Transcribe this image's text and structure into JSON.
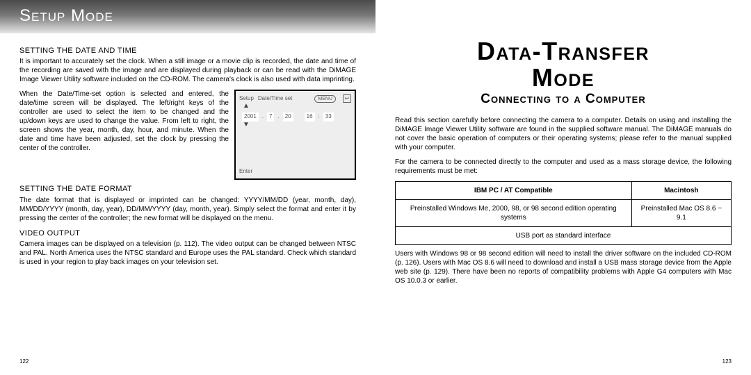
{
  "left": {
    "header": "Setup Mode",
    "h1": "Setting the Date and Time",
    "p1": "It is important to accurately set the clock. When a still image or a movie clip is recorded, the date and time of the recording are saved with the image and are displayed during playback or can be read with the DiMAGE Image Viewer Utility software included on the CD-ROM. The camera's clock is also used with data imprinting.",
    "p2": "When the Date/Time-set option is selected and entered, the date/time screen will be displayed. The left/right keys of the controller are used to select the item to be changed and the up/down keys are used to change the value. From left to right, the screen shows the year, month, day, hour, and minute. When the date and time have been adjusted, set the clock by pressing the center of the controller.",
    "lcd": {
      "setup": "Setup",
      "mode": "Date/Time set",
      "menu": "MENU",
      "year": "2001",
      "month": "7",
      "day": "20",
      "hour": "16",
      "colon": ":",
      "minute": "33",
      "sep": ".",
      "enter": "Enter"
    },
    "h2": "Setting the Date Format",
    "p3": "The date format that is displayed or imprinted can be changed: YYYY/MM/DD (year, month, day), MM/DD/YYYY (month, day, year), DD/MM/YYYY (day, month, year). Simply select the format and enter it by pressing the center of the controller; the new format will be displayed on the menu.",
    "h3": "Video Output",
    "p4": "Camera images can be displayed on a television (p. 112). The video output can be changed between NTSC and PAL. North America uses the NTSC standard and Europe uses the PAL standard. Check which standard is used in your region to play back images on your television set.",
    "pagenum": "122"
  },
  "right": {
    "title_a": "Data-Transfer",
    "title_b": "Mode",
    "subtitle": "Connecting to a Computer",
    "p1": "Read this section carefully before connecting the camera to a computer. Details on using and installing the DiMAGE Image Viewer Utility software are found in the supplied software manual. The DiMAGE manuals do not cover the basic operation of computers or their operating systems; please refer to the manual supplied with your computer.",
    "p2": "For the camera to be connected directly to the computer and used as a mass storage device, the following requirements must be met:",
    "table": {
      "col1h": "IBM PC / AT Compatible",
      "col2h": "Macintosh",
      "cell1": "Preinstalled Windows Me, 2000, 98, or 98 second edition operating systems",
      "cell2": "Preinstalled Mac OS 8.6 ~ 9.1",
      "cell3": "USB port as standard interface"
    },
    "p3": "Users with Windows 98 or 98 second edition will need to install the driver software on the included CD-ROM (p. 126). Users with Mac OS 8.6 will need to download and install a USB mass storage device from the Apple web site (p. 129). There have been no reports of compatibility problems with Apple G4 computers with Mac OS 10.0.3 or earlier.",
    "pagenum": "123"
  }
}
